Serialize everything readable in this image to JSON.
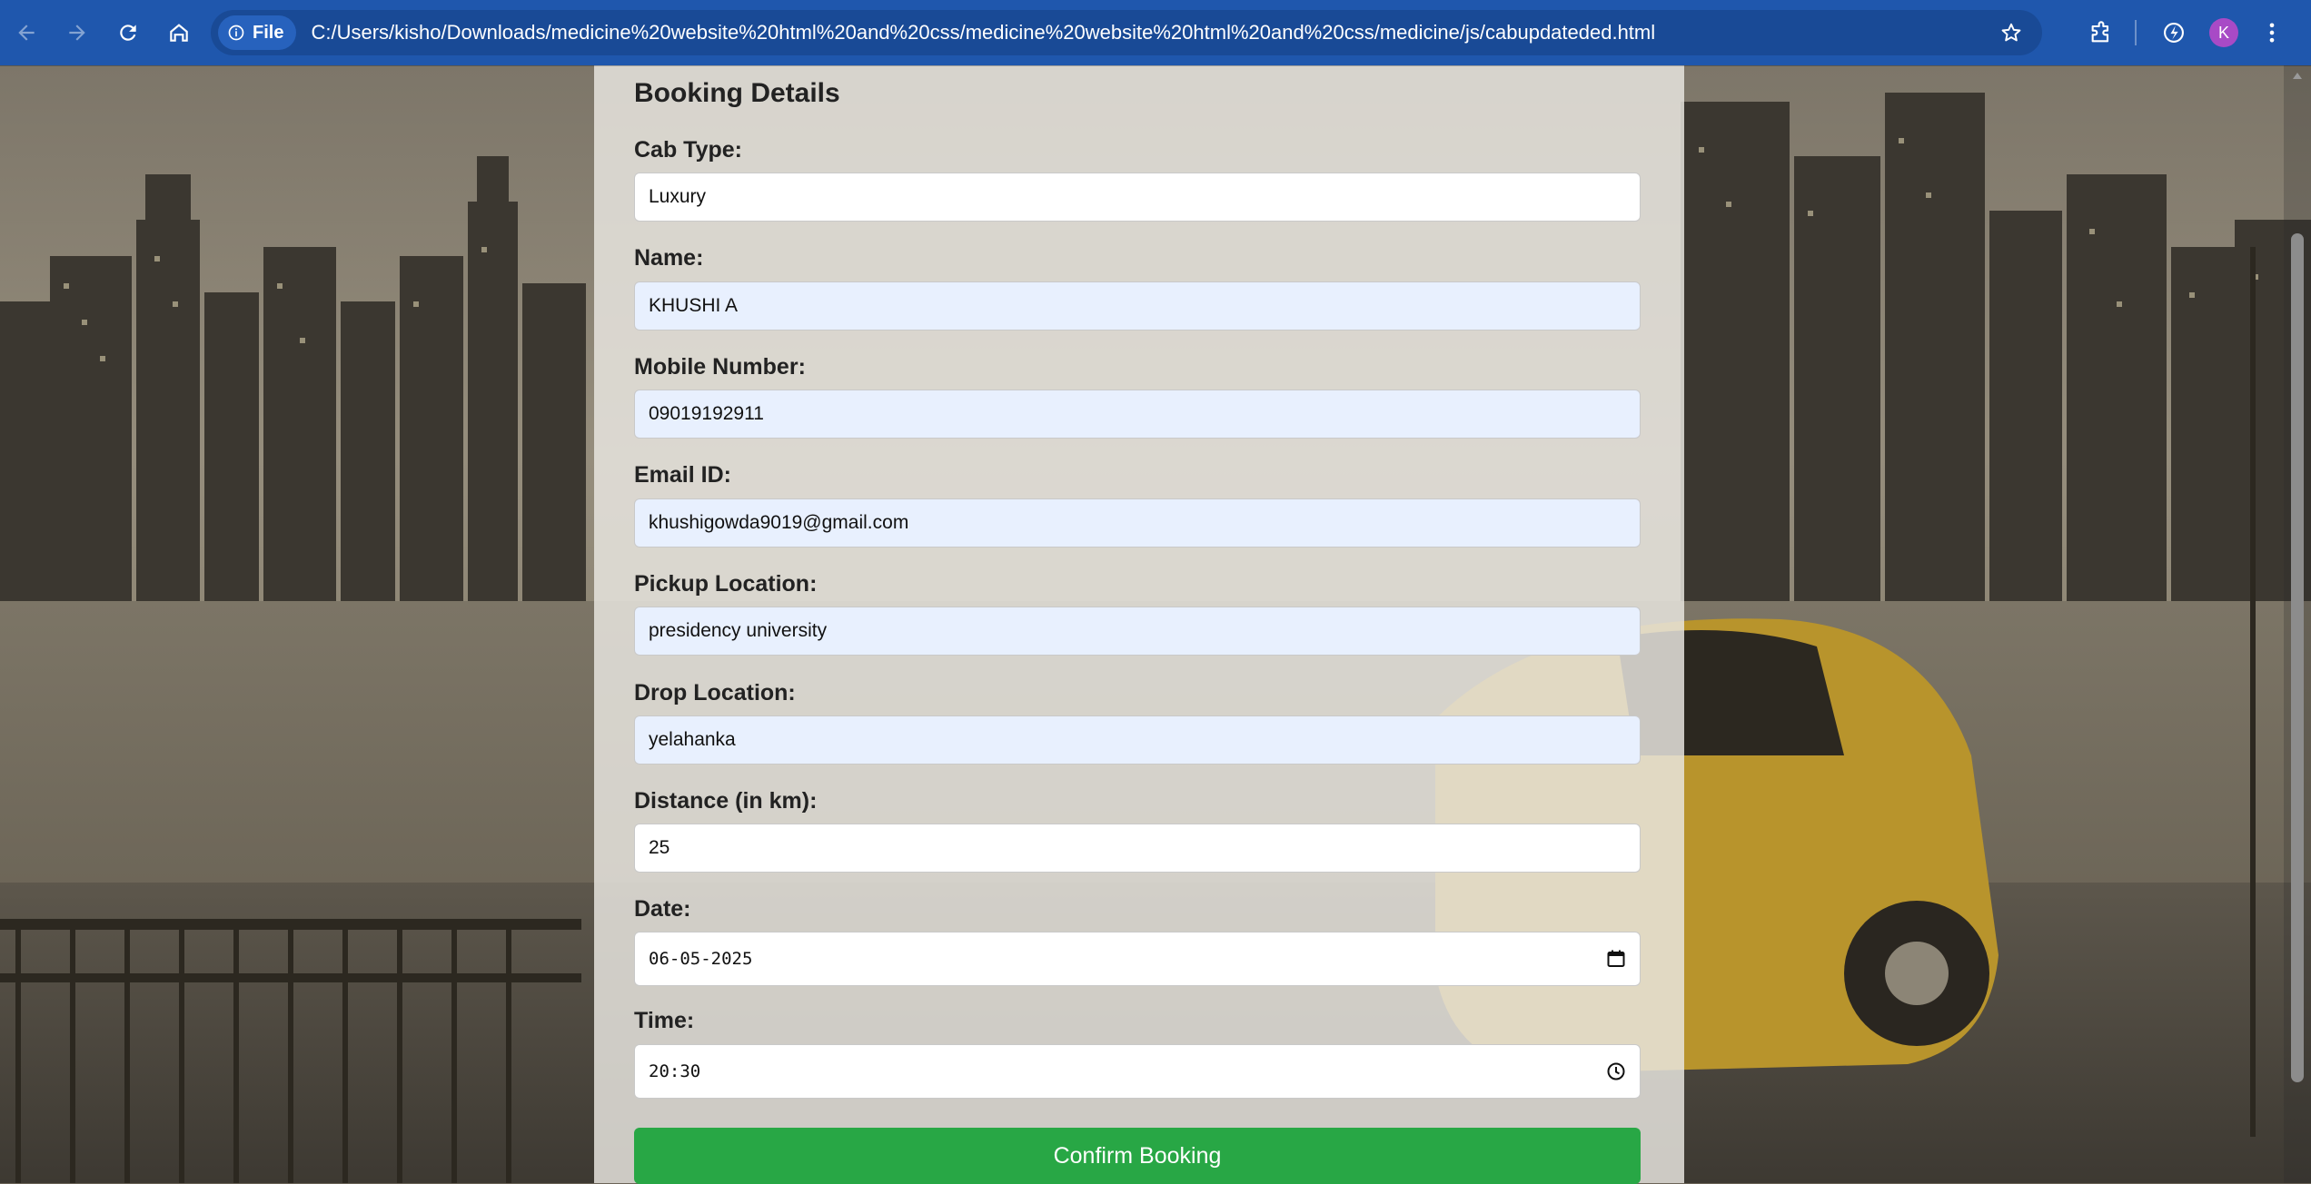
{
  "browser": {
    "chip_label": "File",
    "url": "C:/Users/kisho/Downloads/medicine%20website%20html%20and%20css/medicine%20website%20html%20and%20css/medicine/js/cabupdateded.html",
    "profile_initial": "K",
    "accent_color": "#1f57ad"
  },
  "form": {
    "title": "Booking Details",
    "fields": [
      {
        "label": "Cab Type:",
        "value": "Luxury"
      },
      {
        "label": "Name:",
        "value": "KHUSHI A"
      },
      {
        "label": "Mobile Number:",
        "value": "09019192911"
      },
      {
        "label": "Email ID:",
        "value": "khushigowda9019@gmail.com"
      },
      {
        "label": "Pickup Location:",
        "value": "presidency university"
      },
      {
        "label": "Drop Location:",
        "value": "yelahanka"
      },
      {
        "label": "Distance (in km):",
        "value": "25"
      },
      {
        "label": "Date:",
        "value": "06-05-2025"
      },
      {
        "label": "Time:",
        "value": "20:30"
      }
    ],
    "submit_label": "Confirm Booking",
    "submit_color": "#28a745",
    "autofill_color": "#e8f0fe"
  }
}
